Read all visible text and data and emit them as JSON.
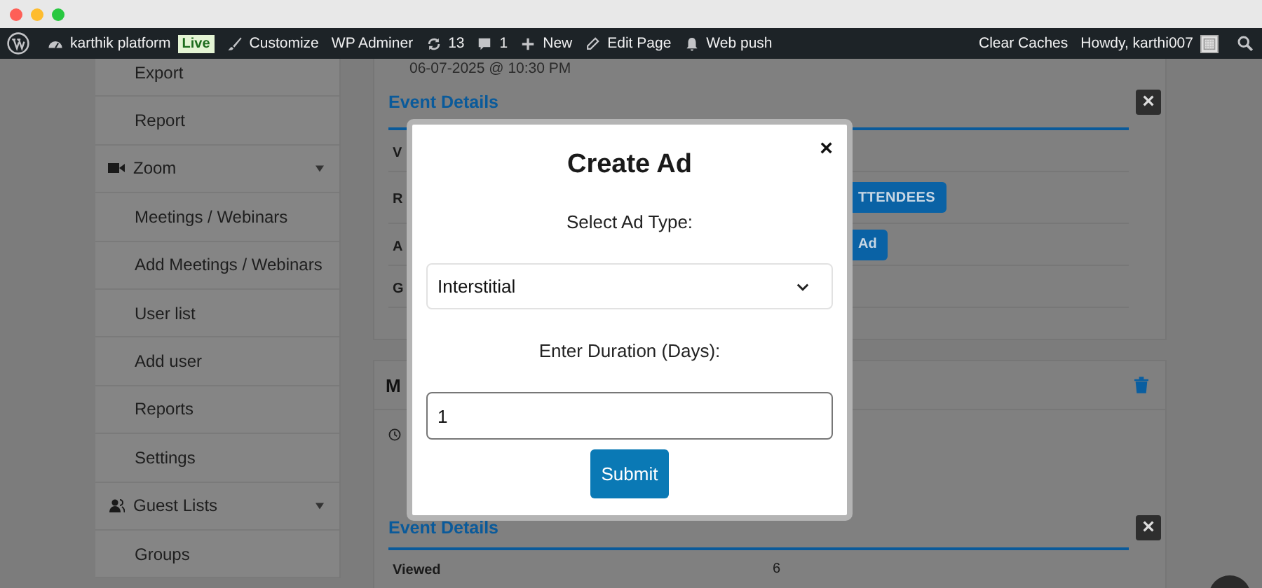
{
  "admin_bar": {
    "left": [
      {
        "kind": "logo"
      },
      {
        "kind": "site",
        "label": "karthik platform"
      },
      {
        "kind": "badge",
        "label": "Live"
      },
      {
        "kind": "customize",
        "label": "Customize"
      },
      {
        "kind": "text",
        "label": "WP Adminer"
      },
      {
        "kind": "updates",
        "label": "13"
      },
      {
        "kind": "comments",
        "label": "1"
      },
      {
        "kind": "new",
        "label": "New"
      },
      {
        "kind": "edit",
        "label": "Edit Page"
      },
      {
        "kind": "notify",
        "label": "Web push"
      }
    ],
    "right": [
      {
        "kind": "text",
        "label": "Clear Caches"
      },
      {
        "kind": "account",
        "label": "Howdy, karthi007"
      },
      {
        "kind": "search"
      }
    ]
  },
  "sidebar": {
    "items": [
      {
        "kind": "link",
        "label": "Export"
      },
      {
        "kind": "link",
        "label": "Report"
      },
      {
        "kind": "video",
        "label": "Zoom"
      },
      {
        "kind": "link",
        "label": "Meetings / Webinars"
      },
      {
        "kind": "link",
        "label": "Add Meetings / Webinars"
      },
      {
        "kind": "link",
        "label": "User list"
      },
      {
        "kind": "link",
        "label": "Add user"
      },
      {
        "kind": "link",
        "label": "Reports"
      },
      {
        "kind": "link",
        "label": "Settings"
      },
      {
        "kind": "guests",
        "label": "Guest Lists"
      },
      {
        "kind": "link",
        "label": "Groups"
      }
    ]
  },
  "event_date": "06-07-2025 @ 10:30 PM",
  "event_card": {
    "title": "Event Details",
    "close": "×",
    "rows": [
      {
        "label": "V"
      },
      {
        "label": "R",
        "button": "TTENDEES"
      },
      {
        "label": "A",
        "button": "Ad"
      },
      {
        "label": "G"
      }
    ]
  },
  "meeting_card": {
    "title": "M"
  },
  "event_card_2": {
    "title": "Event Details",
    "close": "×",
    "rows": [
      {
        "label": "Viewed",
        "value": "6"
      }
    ]
  },
  "modal": {
    "close": "×",
    "title": "Create Ad",
    "type_label": "Select Ad Type:",
    "type_value": "Interstitial",
    "duration_label": "Enter Duration (Days):",
    "duration_value": "1",
    "submit": "Submit"
  }
}
